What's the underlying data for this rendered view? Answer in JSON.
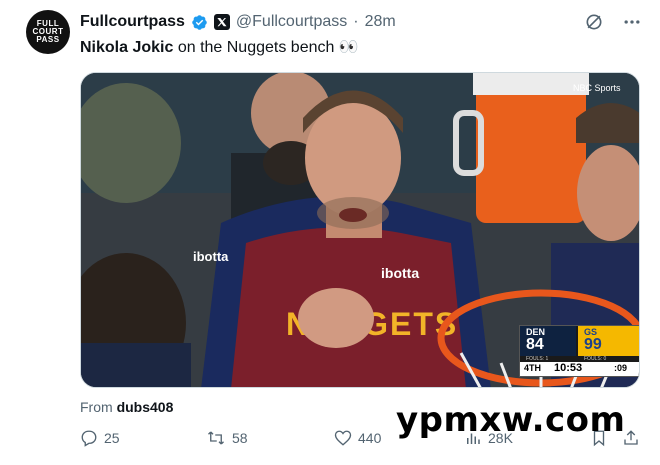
{
  "tweet": {
    "author_name": "Fullcourtpass",
    "handle": "@Fullcourtpass",
    "separator": "·",
    "time": "28m",
    "avatar_text": [
      "FULL",
      "COURT",
      "PASS"
    ],
    "text_bold": "Nikola Jokic",
    "text_rest": " on the Nuggets bench 👀",
    "from_label": "From",
    "from_user": "dubs408",
    "accent_color": "#1d9bf0"
  },
  "media": {
    "jersey_text": "NUGGETS",
    "sponsor": "ibotta",
    "network_logo": "NBC Sports",
    "scorebug": {
      "team_left": "DEN",
      "score_left": "84",
      "team_right": "GS",
      "score_right": "99",
      "fouls_left": "FOULS: 1",
      "fouls_right": "FOULS: 0",
      "quarter": "4TH",
      "clock": "10:53",
      "shot_clock": ":09"
    }
  },
  "actions": {
    "replies": "25",
    "reposts": "58",
    "likes": "440",
    "views": "28K"
  },
  "watermark": "ypmxw.com"
}
